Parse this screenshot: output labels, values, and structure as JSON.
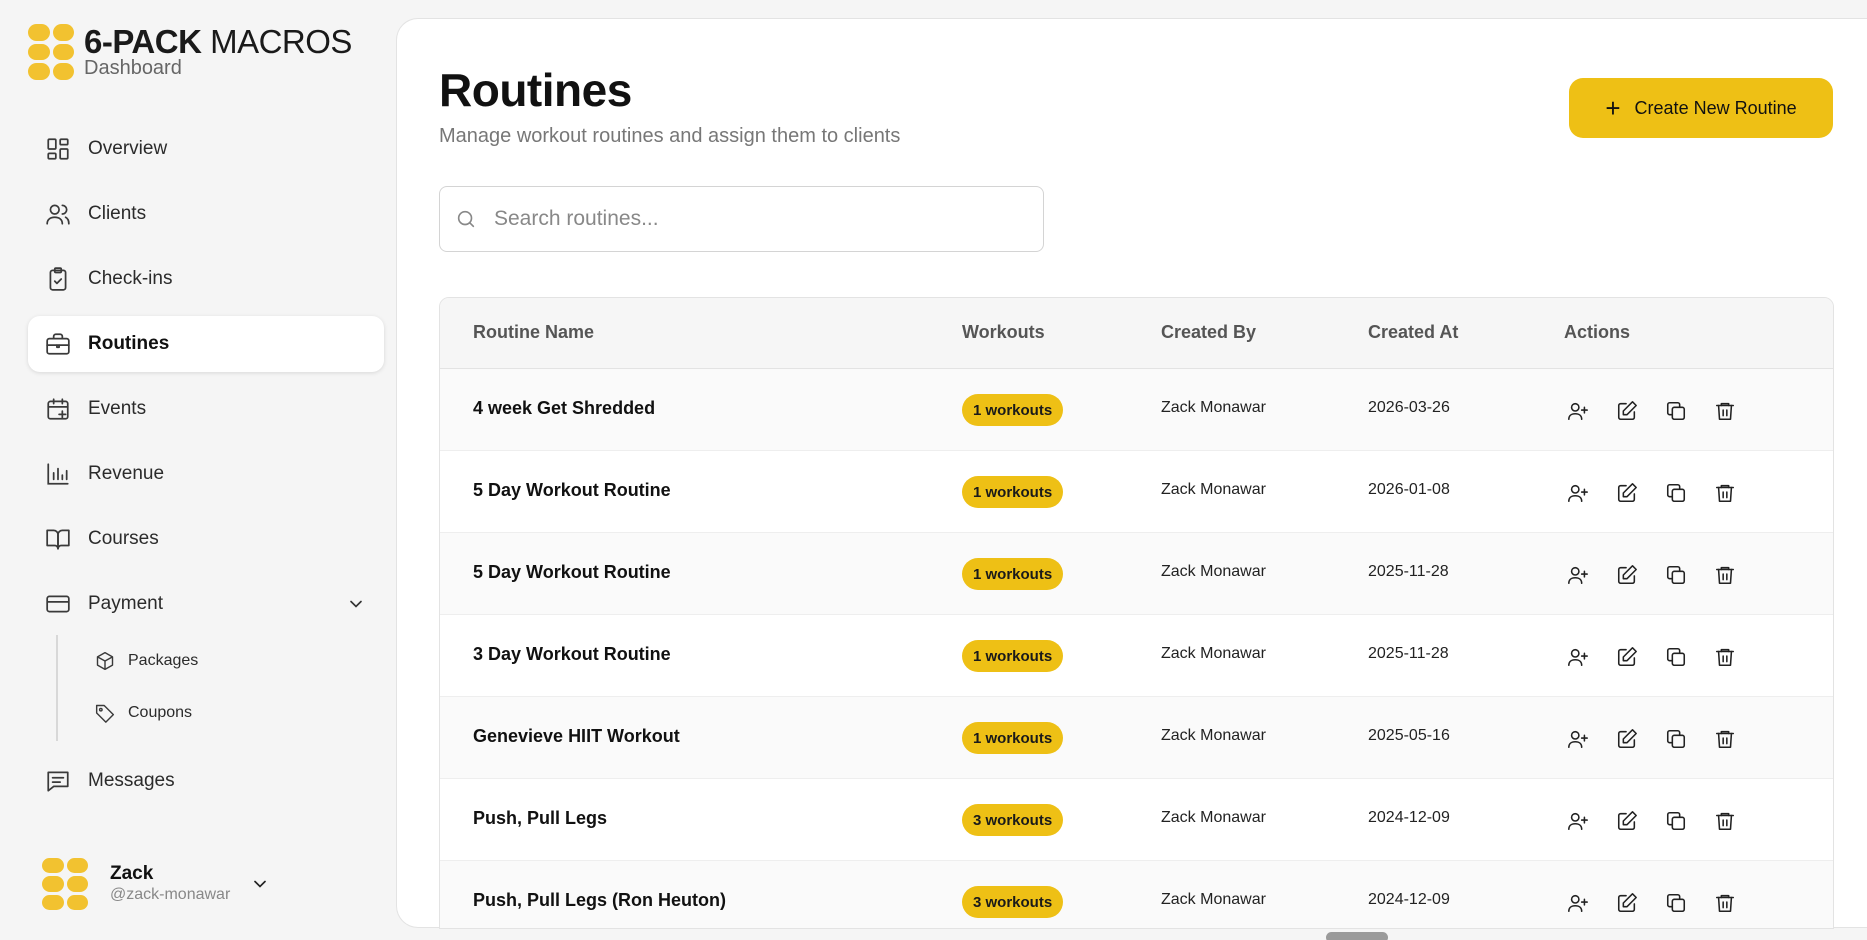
{
  "brand": {
    "name_bold": "6-PACK",
    "name_light": "MACROS",
    "subtitle": "Dashboard"
  },
  "nav": {
    "overview": "Overview",
    "clients": "Clients",
    "checkins": "Check-ins",
    "routines": "Routines",
    "events": "Events",
    "revenue": "Revenue",
    "courses": "Courses",
    "payment": "Payment",
    "packages": "Packages",
    "coupons": "Coupons",
    "messages": "Messages"
  },
  "user": {
    "name": "Zack",
    "handle": "@zack-monawar"
  },
  "page": {
    "title": "Routines",
    "subtitle": "Manage workout routines and assign them to clients",
    "create_label": "Create New Routine",
    "search_placeholder": "Search routines..."
  },
  "table": {
    "headers": {
      "name": "Routine Name",
      "workouts": "Workouts",
      "created_by": "Created By",
      "created_at": "Created At",
      "actions": "Actions"
    },
    "rows": [
      {
        "name": "4 week Get Shredded",
        "workouts": "1 workouts",
        "created_by": "Zack Monawar",
        "created_at": "2026-03-26"
      },
      {
        "name": "5 Day Workout Routine",
        "workouts": "1 workouts",
        "created_by": "Zack Monawar",
        "created_at": "2026-01-08"
      },
      {
        "name": "5 Day Workout Routine",
        "workouts": "1 workouts",
        "created_by": "Zack Monawar",
        "created_at": "2025-11-28"
      },
      {
        "name": "3 Day Workout Routine",
        "workouts": "1 workouts",
        "created_by": "Zack Monawar",
        "created_at": "2025-11-28"
      },
      {
        "name": "Genevieve HIIT Workout",
        "workouts": "1 workouts",
        "created_by": "Zack Monawar",
        "created_at": "2025-05-16"
      },
      {
        "name": "Push, Pull Legs",
        "workouts": "3 workouts",
        "created_by": "Zack Monawar",
        "created_at": "2024-12-09"
      },
      {
        "name": "Push, Pull Legs (Ron Heuton)",
        "workouts": "3 workouts",
        "created_by": "Zack Monawar",
        "created_at": "2024-12-09"
      }
    ]
  },
  "colors": {
    "accent": "#eec015",
    "logo": "#f2c230"
  }
}
